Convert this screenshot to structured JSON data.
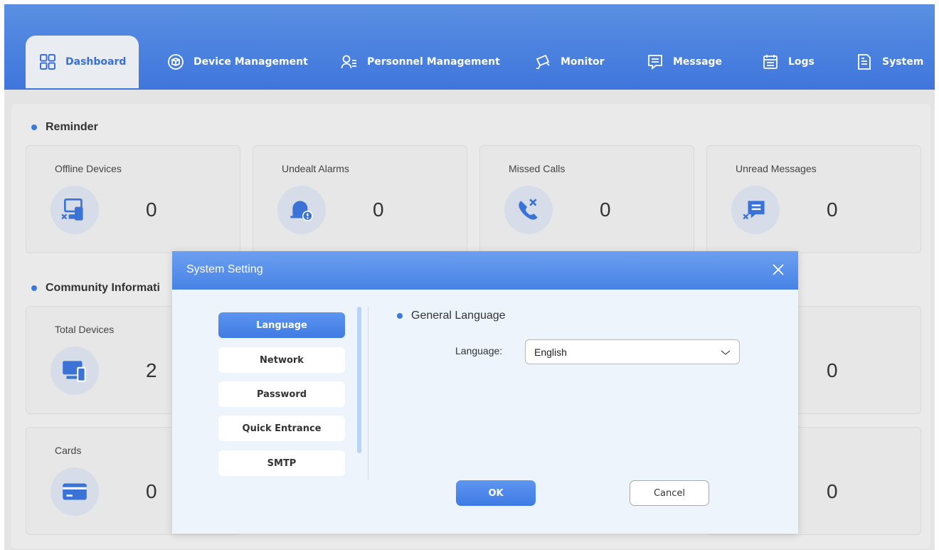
{
  "nav": {
    "tabs": [
      {
        "label": "Dashboard",
        "icon": "dashboard-grid-icon",
        "active": true
      },
      {
        "label": "Device Management",
        "icon": "device-box-icon"
      },
      {
        "label": "Personnel Management",
        "icon": "person-list-icon"
      },
      {
        "label": "Monitor",
        "icon": "camera-monitor-icon"
      },
      {
        "label": "Message",
        "icon": "message-icon"
      },
      {
        "label": "Logs",
        "icon": "calendar-logs-icon"
      },
      {
        "label": "System",
        "icon": "document-system-icon"
      }
    ]
  },
  "reminder": {
    "title": "Reminder",
    "cards": [
      {
        "label": "Offline Devices",
        "value": "0",
        "icon": "offline-devices-icon"
      },
      {
        "label": "Undealt Alarms",
        "value": "0",
        "icon": "alarm-bell-icon"
      },
      {
        "label": "Missed Calls",
        "value": "0",
        "icon": "missed-call-icon"
      },
      {
        "label": "Unread Messages",
        "value": "0",
        "icon": "unread-message-icon"
      }
    ]
  },
  "community": {
    "title": "Community Informati",
    "cards": [
      {
        "label": "Total Devices",
        "value": "2",
        "icon": "devices-icon"
      },
      {
        "label": "Cards",
        "value": "0",
        "icon": "card-icon"
      }
    ],
    "right_values": [
      "0",
      "0"
    ]
  },
  "modal": {
    "title": "System Setting",
    "menu": [
      "Language",
      "Network",
      "Password",
      "Quick Entrance",
      "SMTP"
    ],
    "active_menu": "Language",
    "section_title": "General Language",
    "language_label": "Language:",
    "language_value": "English",
    "ok_label": "OK",
    "cancel_label": "Cancel"
  },
  "colors": {
    "accent": "#3f7be3",
    "header_bg": "#4a80df",
    "dot": "#3a7ae0"
  }
}
